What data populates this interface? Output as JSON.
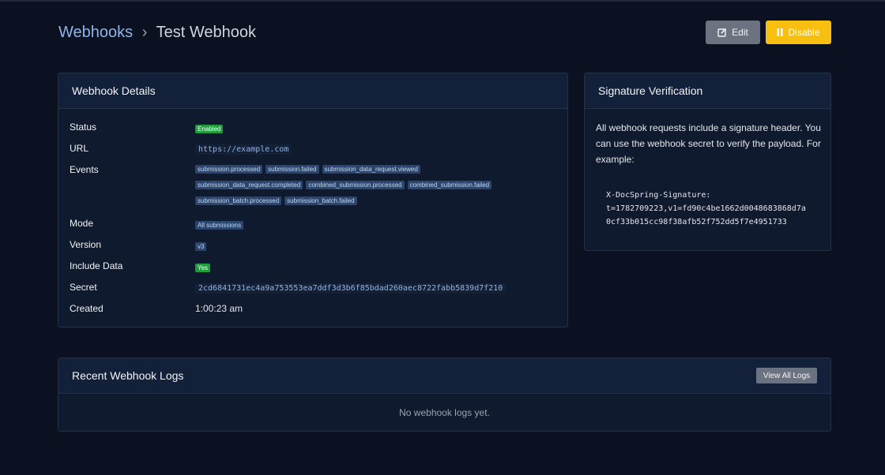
{
  "breadcrumb": {
    "parent": "Webhooks",
    "separator": "›",
    "current": "Test Webhook"
  },
  "actions": {
    "edit_label": "Edit",
    "disable_label": "Disable"
  },
  "details": {
    "title": "Webhook Details",
    "status_label": "Status",
    "status_value": "Enabled",
    "url_label": "URL",
    "url_value": "https://example.com",
    "events_label": "Events",
    "events": [
      "submission.processed",
      "submission.failed",
      "submission_data_request.viewed",
      "submission_data_request.completed",
      "combined_submission.processed",
      "combined_submission.failed",
      "submission_batch.processed",
      "submission_batch.failed"
    ],
    "mode_label": "Mode",
    "mode_value": "All submissions",
    "version_label": "Version",
    "version_value": "v3",
    "include_data_label": "Include Data",
    "include_data_value": "Yes",
    "secret_label": "Secret",
    "secret_value": "2cd6841731ec4a9a753553ea7ddf3d3b6f85bdad260aec8722fabb5839d7f210",
    "created_label": "Created",
    "created_value": "1:00:23 am"
  },
  "signature": {
    "title": "Signature Verification",
    "description": "All webhook requests include a signature header. You can use the webhook secret to verify the payload. For example:",
    "code_line1": "X-DocSpring-Signature:",
    "code_line2": "t=1782709223,v1=fd90c4be1662d0048683868d7a",
    "code_line3": "0cf33b015cc98f38afb52f752dd5f7e4951733"
  },
  "logs": {
    "title": "Recent Webhook Logs",
    "view_all_label": "View All Logs",
    "empty_text": "No webhook logs yet."
  },
  "colors": {
    "background": "#0b1121",
    "card": "#0f1a2e",
    "accent": "#8fb4e6",
    "warning": "#f7c010",
    "success": "#1f9d3f"
  }
}
